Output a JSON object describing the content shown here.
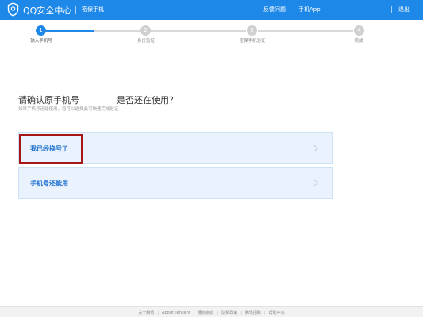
{
  "header": {
    "brand": "QQ安全中心",
    "subtitle": "密保手机",
    "nav": {
      "feedback": "反馈问题",
      "app": "手机App",
      "logout": "退出"
    }
  },
  "steps": [
    {
      "num": "1",
      "label": "输入手机号",
      "active": true
    },
    {
      "num": "2",
      "label": "身份验证",
      "active": false
    },
    {
      "num": "3",
      "label": "密保手机验证",
      "active": false
    },
    {
      "num": "4",
      "label": "完成",
      "active": false
    }
  ],
  "main": {
    "question_start": "请确认原手机号",
    "question_end": "是否还在使用？",
    "hint": "如果手机号还能使用，您可以选择此可快速完成验证",
    "options": [
      {
        "label": "我已经换号了"
      },
      {
        "label": "手机号还能用"
      }
    ]
  },
  "footer": {
    "links": [
      "关于腾讯",
      "About Tencent",
      "服务条款",
      "隐私政策",
      "腾讯招聘",
      "帮助中心"
    ]
  },
  "colors": {
    "accent": "#1e88e8",
    "highlight": "#a51616",
    "option_bg": "#eaf3fd"
  }
}
